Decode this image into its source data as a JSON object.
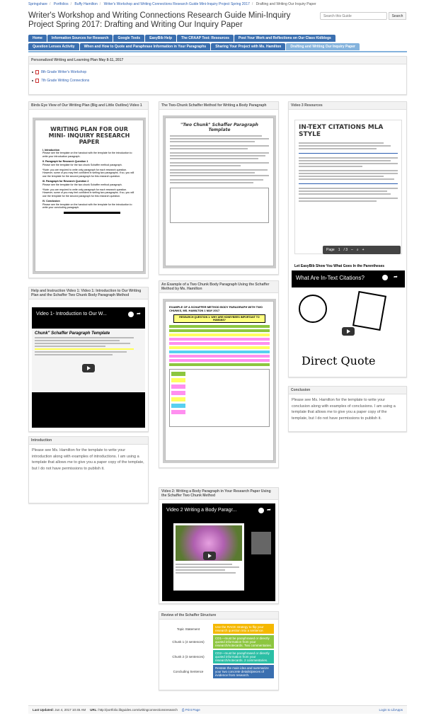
{
  "breadcrumb": [
    "Springshare",
    "Portfolios",
    "Buffy Hamilton",
    "Writer's Workshop and Writing Connections Research Guide Mini-Inquiry Project Spring 2017",
    "Drafting and Writing Our Inquiry Paper"
  ],
  "page_title": "Writer's Workshop and Writing Connections Research Guide Mini-Inquiry Project Spring 2017: Drafting and Writing Our Inquiry Paper",
  "search": {
    "placeholder": "Search this Guide",
    "button": "Search"
  },
  "nav": {
    "row1": [
      "Home",
      "Information Sources for Research",
      "Google Tools",
      "EasyBib Help",
      "The CRAAP Test: Resources",
      "Post Your Work and Reflections on Our Class Kidblogs"
    ],
    "row2": [
      "Question Lenses Activity",
      "When and How to Quote and Paraphrase Information in Your Paragraphs",
      "Sharing Your Project with Ms. Hamilton",
      "Drafting and Writing Our Inquiry Paper"
    ]
  },
  "personalized": {
    "header": "Personalized Writing and Learning Plan May 8-11, 2017",
    "links": [
      "8th Grade Writer's Workshop",
      "7th Grade Writing Connections"
    ]
  },
  "birds_eye": {
    "header": "Birds Eye View of Our Writing Plan (Big and Little Outline) Video 1",
    "doc_title": "WRITING PLAN FOR OUR MINI- INQUIRY RESEARCH PAPER",
    "items": [
      {
        "num": "I.",
        "head": "Introduction",
        "text": "Please see the template on the handout with the template for the introduction to write your introduction paragraph."
      },
      {
        "num": "II.",
        "head": "Paragraph for Research Question 1",
        "text": "Please see the template for the two chunk Schaffer method paragraph."
      },
      {
        "num": "",
        "head": "",
        "text": "*Note: you are required to write only paragraph for each research question. However, some of you may feel confident in writing two paragraphs. If so, you will use the template for the second paragraph for this research question."
      },
      {
        "num": "III.",
        "head": "Paragraph for Research Question 2",
        "text": "Please see the template for the two chunk Schaffer method paragraph."
      },
      {
        "num": "",
        "head": "",
        "text": "*Note: you are required to write only paragraph for each research question. However, some of you may feel confident in writing two paragraphs. If so, you will use the template for the second paragraph for this research question."
      },
      {
        "num": "IV.",
        "head": "Conclusion",
        "text": "Please see the template on the handout with the template for the introduction to write your concluding paragraph."
      }
    ]
  },
  "two_chunk": {
    "header": "The Two-Chunk Schaffer Method for Writing a Body Paragraph",
    "doc_title": "\"Two Chunk\" Schaffer Paragraph Template"
  },
  "example": {
    "header": "An Example of a Two Chunk Body Paragraph Using the Schaffer Method by Ms. Hamilton",
    "doc_title": "EXAMPLE OF A SCHAFFER METHOD BODY PARAGRAPH WITH TWO CHUNKS, MS. HAMILTON 1 MAY 2017",
    "question": "RESEARCH QUESTION 1: WHY ARE HONEYBEES IMPORTANT TO HUMANS?"
  },
  "video3": {
    "header": "Video 3 Resources",
    "doc_title": "IN-TEXT CITATIONS MLA STYLE",
    "page_label": "Page",
    "page_num": "1",
    "page_total": "/ 3",
    "video_title": "What Are In-Text Citations?",
    "tooltip": "Let EasyBib Show You What Goes In the Parentheses",
    "direct_quote": "Direct Quote"
  },
  "help": {
    "header": "Help and Instruction Video 1: Video 1: Introduction to Our Writing Plan and the Schaffer Two Chunk Body Paragraph Method",
    "video_title": "Video 1- Introduction to Our W...",
    "template_title": "Chunk\" Schaffer Paragraph Template"
  },
  "introduction": {
    "header": "Introduction",
    "text": "Please see Ms. Hamilton for the template to write your introduction along with examples of introductions. I am using a template that allows me to give you a paper copy of the template, but I do not have permissions to publish it."
  },
  "conclusion": {
    "header": "Conclusion",
    "text": "Please see Ms. Hamilton for the template to write your conclusion along with examples of conclusions. I am using a template that allows me to give you a paper copy of the template, but I do not have permissions to publish it."
  },
  "video2": {
    "header": "Video 2: Writing a Body Paragraph in Your Research Paper Using the Schaffer Two Chunk Method",
    "video_title": "Video 2 Writing a Body Paragr..."
  },
  "review": {
    "header": "Review of the Schaffer Structure",
    "rows": [
      {
        "label": "Topic Statement",
        "text": "Use the RACE strategy to flip your research question into a sentence.",
        "color": "#f5b800"
      },
      {
        "label": "Chunk 1 (4 sentences)",
        "text": "CD1—must be paraphrased or directly quoted information from your research/notecards. Two commentaries.",
        "color": "#8dc63f"
      },
      {
        "label": "Chunk 2 (3 sentences)",
        "text": "CD2—must be paraphrased or directly quoted information from your research/notecards. 2 commentaries.",
        "color": "#2bbfa5"
      },
      {
        "label": "Concluding Sentence",
        "text": "Restate the main idea and summarize your two concrete details/pieces of evidence from research.",
        "color": "#3a6fb0"
      }
    ]
  },
  "footer": {
    "updated_label": "Last Updated:",
    "updated": "Jun 4, 2017 10:45 AM",
    "url_label": "URL:",
    "url": "http://portfolio.libguides.com/writingconnectionsresearch",
    "print": "Print Page",
    "login": "Login to LibApps"
  }
}
